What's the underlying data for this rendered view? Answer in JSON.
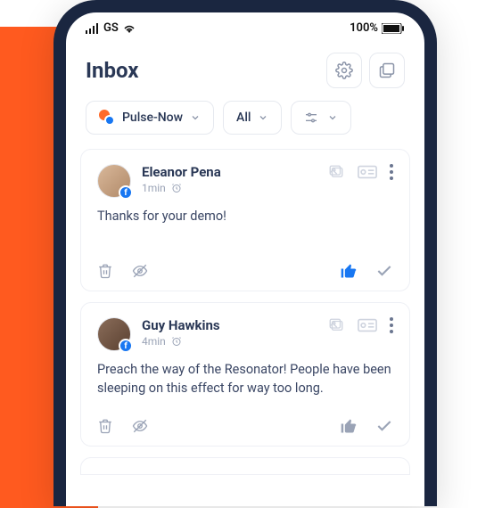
{
  "statusbar": {
    "carrier": "GS",
    "battery": "100%"
  },
  "header": {
    "title": "Inbox"
  },
  "filters": {
    "account_label": "Pulse-Now",
    "scope_label": "All"
  },
  "messages": [
    {
      "name": "Eleanor Pena",
      "time": "1min",
      "body": "Thanks for your demo!",
      "liked": true
    },
    {
      "name": "Guy Hawkins",
      "time": "4min",
      "body": "Preach the way of the Resonator! People have been sleeping on this effect for way too long.",
      "liked": false
    }
  ]
}
